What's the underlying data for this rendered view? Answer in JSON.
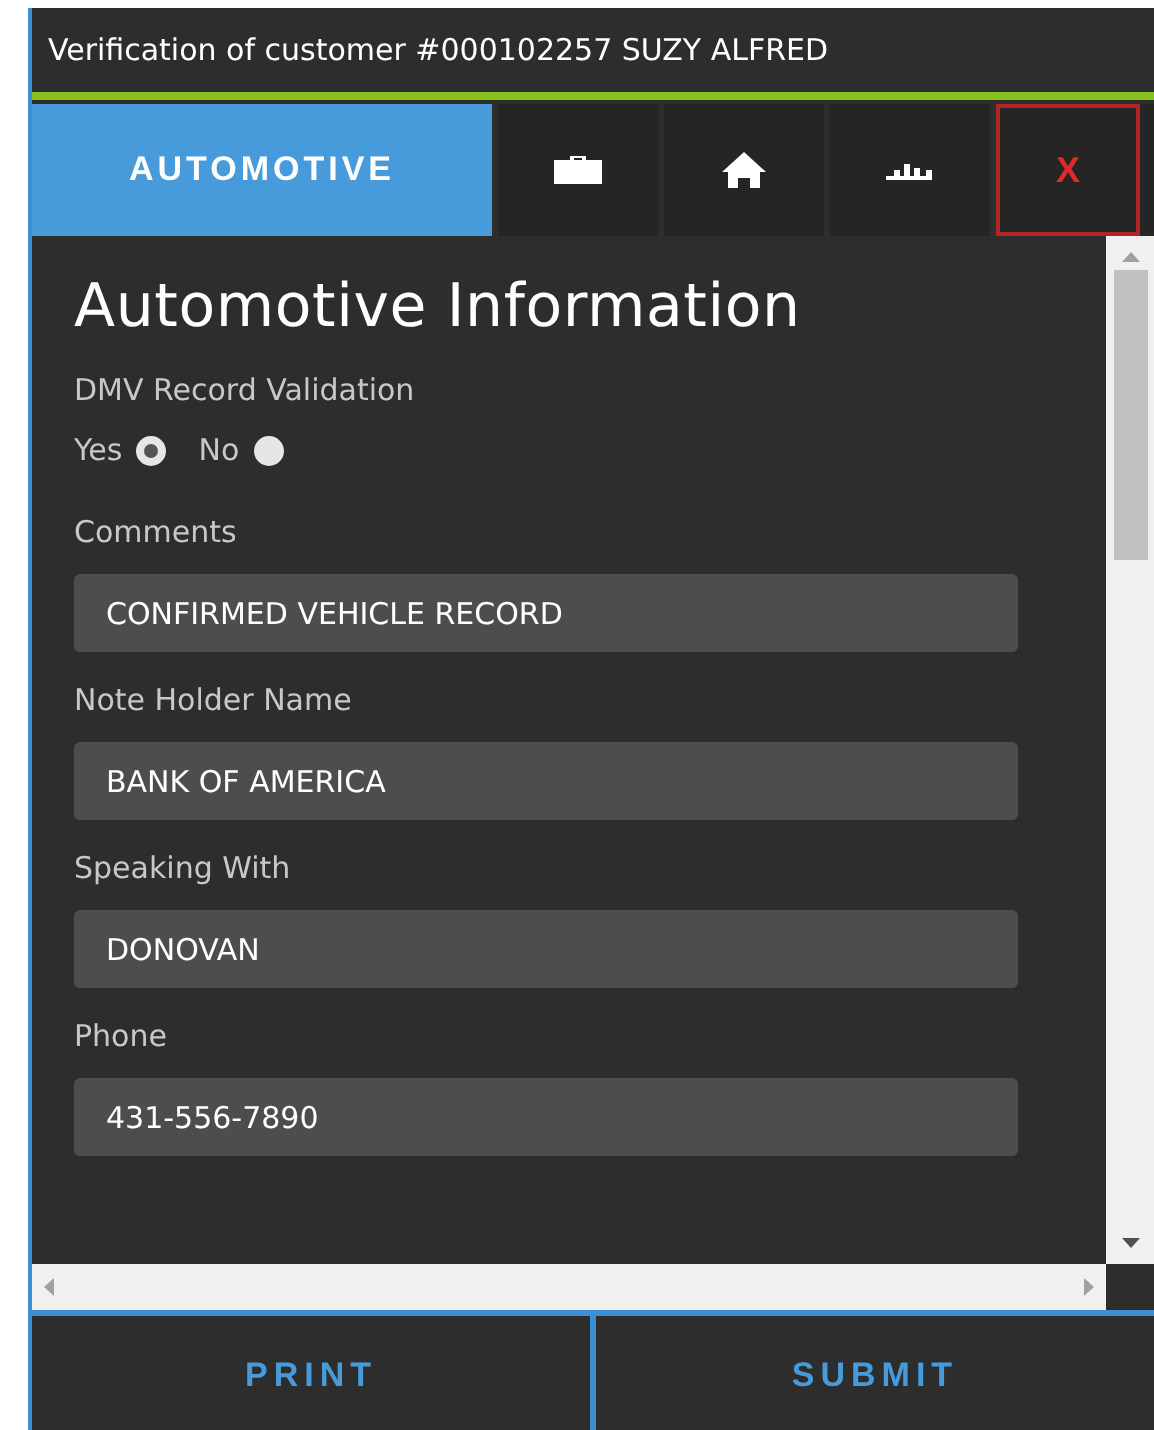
{
  "window": {
    "title": "Verification of customer #000102257 SUZY ALFRED"
  },
  "tabs": [
    {
      "kind": "text",
      "label": "AUTOMOTIVE",
      "selected": true
    },
    {
      "kind": "briefcase",
      "selected": false
    },
    {
      "kind": "home",
      "selected": false
    },
    {
      "kind": "chart",
      "selected": false
    },
    {
      "kind": "close",
      "label": "X",
      "selected": false
    }
  ],
  "section": {
    "heading": "Automotive Information",
    "validation": {
      "label": "DMV Record Validation",
      "options": [
        {
          "label": "Yes",
          "selected": true
        },
        {
          "label": "No",
          "selected": false
        }
      ]
    },
    "fields": [
      {
        "label": "Comments",
        "value": "CONFIRMED VEHICLE RECORD"
      },
      {
        "label": "Note Holder Name",
        "value": "BANK OF AMERICA"
      },
      {
        "label": "Speaking With",
        "value": "DONOVAN"
      },
      {
        "label": "Phone",
        "value": "431-556-7890"
      }
    ]
  },
  "buttons": [
    "PRINT",
    "SUBMIT"
  ]
}
